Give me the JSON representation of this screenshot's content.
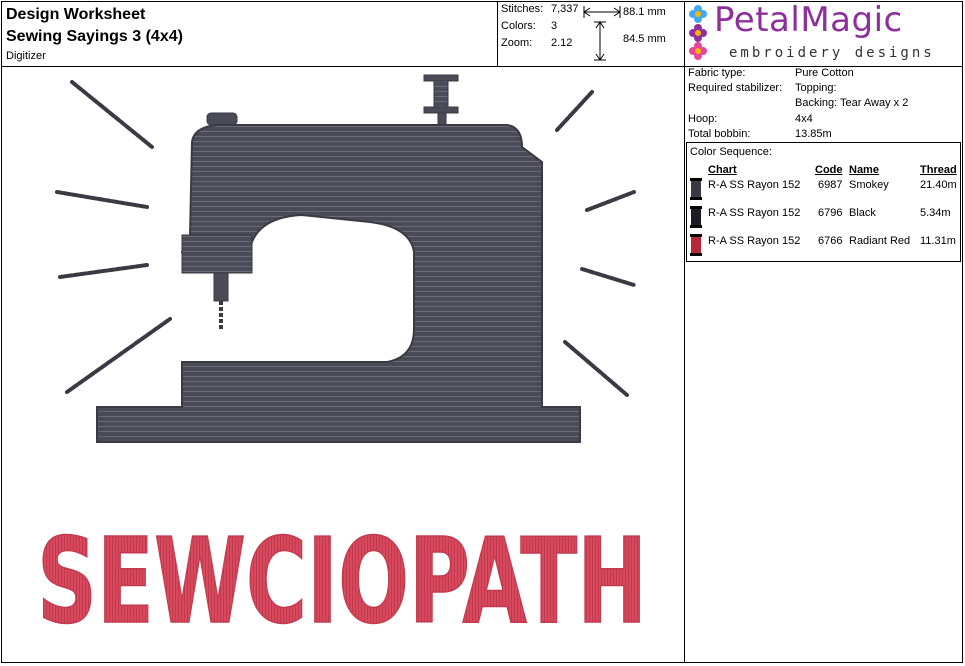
{
  "header": {
    "title": "Design Worksheet",
    "design_name": "Sewing Sayings 3 (4x4)",
    "subtitle": "Digitizer"
  },
  "stats": {
    "stitches_label": "Stitches:",
    "stitches_value": "7,337",
    "colors_label": "Colors:",
    "colors_value": "3",
    "zoom_label": "Zoom:",
    "zoom_value": "2.12",
    "width": "88.1 mm",
    "height": "84.5 mm"
  },
  "brand": {
    "name": "PetalMagic",
    "tagline": "embroidery designs",
    "colors": [
      "#8e2f9e",
      "#3fa9f5",
      "#f7b500",
      "#e8459a"
    ]
  },
  "info": {
    "fabric_label": "Fabric type:",
    "fabric_value": "Pure Cotton",
    "stabilizer_label": "Required stabilizer:",
    "topping_value": "Topping:",
    "backing_value": "Backing: Tear Away x 2",
    "hoop_label": "Hoop:",
    "hoop_value": "4x4",
    "bobbin_label": "Total bobbin:",
    "bobbin_value": "13.85m"
  },
  "color_sequence": {
    "title": "Color Sequence:",
    "headers": {
      "chart": "Chart",
      "code": "Code",
      "name": "Name",
      "thread": "Thread"
    },
    "rows": [
      {
        "chart": "R-A SS Rayon 152",
        "code": "6987",
        "name": "Smokey",
        "thread": "21.40m",
        "color": "#3a3a44"
      },
      {
        "chart": "R-A SS Rayon 152",
        "code": "6796",
        "name": "Black",
        "thread": "5.34m",
        "color": "#1c1c22"
      },
      {
        "chart": "R-A SS Rayon 152",
        "code": "6766",
        "name": "Radiant Red",
        "thread": "11.31m",
        "color": "#b8263a"
      }
    ]
  },
  "design": {
    "word": "SEWCIOPATH",
    "machine_color": "#4b4b57",
    "text_color": "#d9495d"
  }
}
